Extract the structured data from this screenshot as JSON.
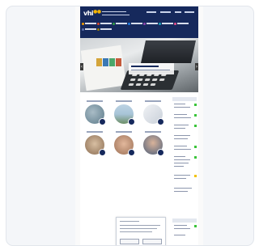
{
  "brand": {
    "logo_text": "vhi",
    "accent": "#f4b400",
    "header_color": "#16295c"
  },
  "menu_colors": [
    "#f29b00",
    "#d9472b",
    "#2f9e44",
    "#1f7ae0",
    "#8e44ad",
    "#16a3b8",
    "#e74c8b",
    "#5b6ea8",
    "#9a7d0a",
    "#2c3e50"
  ],
  "hero": {
    "prev_glyph": "‹",
    "next_glyph": "›"
  },
  "tiles": [
    {
      "image": "training-photo",
      "color": "#7c9aa8"
    },
    {
      "image": "landscape-photo",
      "color": "#95b3c7"
    },
    {
      "image": "document-photo",
      "color": "#dfe4ea"
    },
    {
      "image": "meeting-photo",
      "color": "#b49a7e"
    },
    {
      "image": "people-photo",
      "color": "#c59c82"
    },
    {
      "image": "portrait-photo",
      "color": "#7e8da3"
    }
  ],
  "status_colors": {
    "ok": "#3ac43a",
    "warn": "#f2c200"
  }
}
